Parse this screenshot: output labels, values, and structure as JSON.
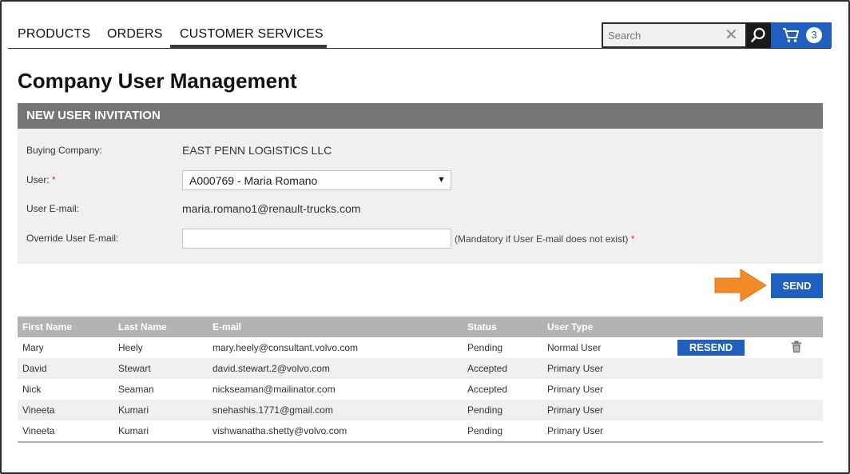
{
  "nav": {
    "items": [
      "PRODUCTS",
      "ORDERS",
      "CUSTOMER SERVICES"
    ],
    "active": "CUSTOMER SERVICES"
  },
  "search": {
    "placeholder": "Search",
    "value": ""
  },
  "cart": {
    "count": "3"
  },
  "page_title": "Company User Management",
  "invitation": {
    "header": "NEW USER INVITATION",
    "buying_company_label": "Buying Company:",
    "buying_company_value": "EAST PENN LOGISTICS LLC",
    "user_label": "User:",
    "required_mark": "*",
    "user_selected": "A000769 - Maria Romano",
    "email_label": "User E-mail:",
    "email_value": "maria.romano1@renault-trucks.com",
    "override_label": "Override User E-mail:",
    "override_value": "",
    "mandatory_note": "(Mandatory if User E-mail does not exist)",
    "send_label": "SEND"
  },
  "table": {
    "headers": [
      "First Name",
      "Last Name",
      "E-mail",
      "Status",
      "User Type"
    ],
    "resend_label": "RESEND",
    "rows": [
      {
        "first": "Mary",
        "last": "Heely",
        "email": "mary.heely@consultant.volvo.com",
        "status": "Pending",
        "type": "Normal User"
      },
      {
        "first": "David",
        "last": "Stewart",
        "email": "david.stewart.2@volvo.com",
        "status": "Accepted",
        "type": "Primary User"
      },
      {
        "first": "Nick",
        "last": "Seaman",
        "email": "nickseaman@mailinator.com",
        "status": "Accepted",
        "type": "Primary User"
      },
      {
        "first": "Vineeta",
        "last": "Kumari",
        "email": "snehashis.1771@gmail.com",
        "status": "Pending",
        "type": "Primary User"
      },
      {
        "first": "Vineeta",
        "last": "Kumari",
        "email": "vishwanatha.shetty@volvo.com",
        "status": "Pending",
        "type": "Primary User"
      }
    ]
  },
  "colors": {
    "accent": "#1f5fbf",
    "header_gray": "#767676",
    "panel_bg": "#f0f0f0",
    "callout_arrow": "#f28a25"
  }
}
